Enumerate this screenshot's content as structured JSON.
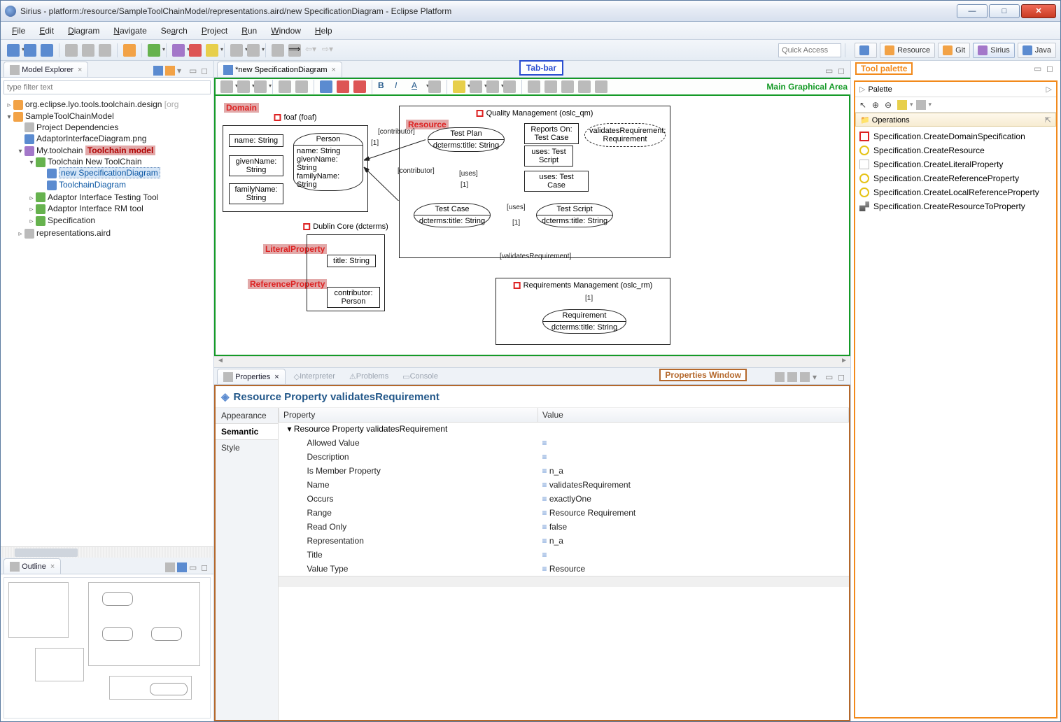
{
  "window": {
    "title": "Sirius - platform:/resource/SampleToolChainModel/representations.aird/new SpecificationDiagram - Eclipse Platform"
  },
  "menu": {
    "items": [
      "File",
      "Edit",
      "Diagram",
      "Navigate",
      "Search",
      "Project",
      "Run",
      "Window",
      "Help"
    ]
  },
  "quick_access": {
    "placeholder": "Quick Access"
  },
  "perspectives": [
    {
      "label": "Resource",
      "active": false
    },
    {
      "label": "Git",
      "active": false
    },
    {
      "label": "Sirius",
      "active": true
    },
    {
      "label": "Java",
      "active": false
    }
  ],
  "explorer": {
    "tab": "Model Explorer",
    "filter_placeholder": "type filter text",
    "nodes": {
      "n0": "org.eclipse.lyo.tools.toolchain.design",
      "n0_suffix": "[org",
      "n1": "SampleToolChainModel",
      "n1a": "Project Dependencies",
      "n1b": "AdaptorInterfaceDiagram.png",
      "n1c": "My.toolchain",
      "n1c_tag": "Toolchain model",
      "n1c1": "Toolchain New ToolChain",
      "n1c1a": "new SpecificationDiagram",
      "n1c1b": "ToolchainDiagram",
      "n1c2": "Adaptor Interface Testing Tool",
      "n1c3": "Adaptor Interface RM tool",
      "n1c4": "Specification",
      "n1d": "representations.aird"
    }
  },
  "outline": {
    "tab": "Outline"
  },
  "editor": {
    "tab": "*new SpecificationDiagram",
    "tab_bar_label": "Tab-bar",
    "main_area_label": "Main Graphical Area"
  },
  "diagram": {
    "annotations": {
      "domain": "Domain",
      "resource": "Resource",
      "literal": "LiteralProperty",
      "reference": "ReferenceProperty"
    },
    "foaf": {
      "title": "foaf (foaf)",
      "slots": [
        "name: String",
        "givenName: String",
        "familyName: String"
      ],
      "person": {
        "name": "Person",
        "attrs": [
          "name: String",
          "givenName: String",
          "familyName: String"
        ]
      }
    },
    "dcterms": {
      "title": "Dublin Core (dcterms)",
      "literal": "title: String",
      "reference": "contributor: Person"
    },
    "qm": {
      "title": "Quality Management (oslc_qm)",
      "testplan": {
        "name": "Test Plan",
        "attr": "dcterms:title: String"
      },
      "testcase": {
        "name": "Test Case",
        "attr": "dcterms:title: String"
      },
      "testscript": {
        "name": "Test Script",
        "attr": "dcterms:title: String"
      },
      "reportson": "Reports On: Test Case",
      "uses_ts": "uses: Test Script",
      "uses_tc": "uses: Test Case",
      "validates": "validatesRequirement: Requirement"
    },
    "rm": {
      "title": "Requirements Management (oslc_rm)",
      "requirement": {
        "name": "Requirement",
        "attr": "dcterms:title: String"
      }
    },
    "edges": {
      "contributor1": "[contributor]",
      "contributor1m": "[1]",
      "contributor2": "[contributor]",
      "uses1": "[uses]",
      "uses1m": "[1]",
      "uses2": "[uses]",
      "uses2m": "[1]",
      "validates": "[validatesRequirement]",
      "one": "[1]"
    }
  },
  "palette": {
    "label": "Tool palette",
    "header": "Palette",
    "section": "Operations",
    "items": [
      "Specification.CreateDomainSpecification",
      "Specification.CreateResource",
      "Specification.CreateLiteralProperty",
      "Specification.CreateReferenceProperty",
      "Specification.CreateLocalReferenceProperty",
      "Specification.CreateResourceToProperty"
    ]
  },
  "bottom_tabs": [
    "Properties",
    "Interpreter",
    "Problems",
    "Console"
  ],
  "properties": {
    "label": "Properties Window",
    "title_prefix": "Resource Property ",
    "title_name": "validatesRequirement",
    "categories": [
      "Appearance",
      "Semantic",
      "Style"
    ],
    "columns": [
      "Property",
      "Value"
    ],
    "group": "Resource Property validatesRequirement",
    "rows": [
      {
        "k": "Allowed Value",
        "v": ""
      },
      {
        "k": "Description",
        "v": ""
      },
      {
        "k": "Is Member Property",
        "v": "n_a"
      },
      {
        "k": "Name",
        "v": "validatesRequirement"
      },
      {
        "k": "Occurs",
        "v": "exactlyOne"
      },
      {
        "k": "Range",
        "v": "Resource Requirement"
      },
      {
        "k": "Read Only",
        "v": "false"
      },
      {
        "k": "Representation",
        "v": "n_a"
      },
      {
        "k": "Title",
        "v": ""
      },
      {
        "k": "Value Type",
        "v": "Resource"
      }
    ]
  }
}
